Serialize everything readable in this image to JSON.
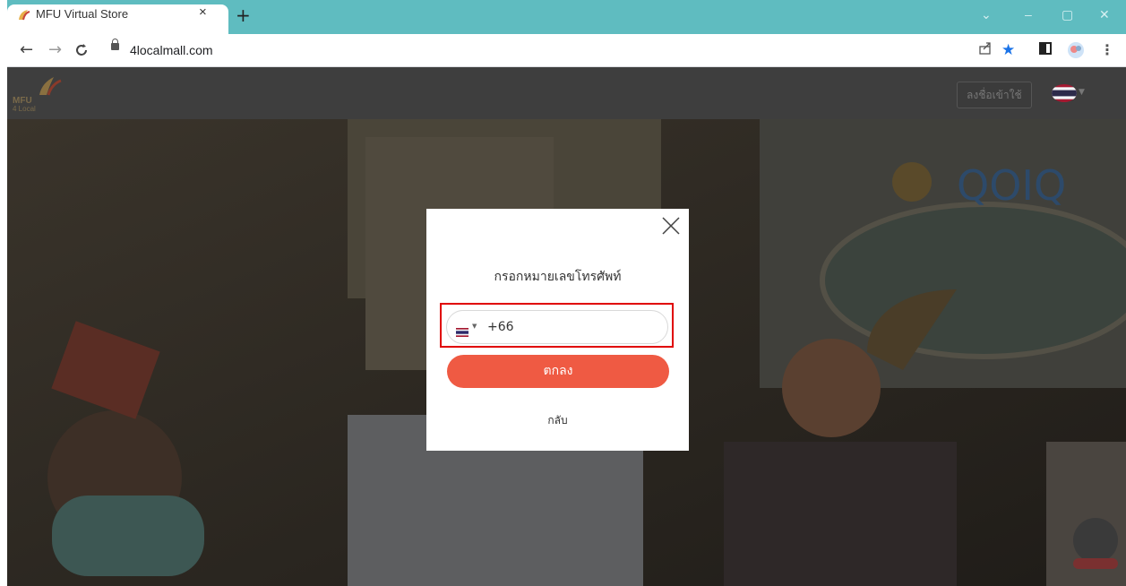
{
  "browser": {
    "tab_title": "MFU Virtual Store",
    "tab_close": "×",
    "new_tab": "+",
    "url": "4localmall.com",
    "controls": {
      "minimize": "–",
      "maximize": "▢",
      "close": "✕",
      "tab_search": "⌄"
    }
  },
  "site": {
    "logo_line1": "MFU",
    "logo_line2": "4 Local",
    "login_label": "ลงชื่อเข้าใช้",
    "language": "Thai flag"
  },
  "modal": {
    "title": "กรอกหมายเลขโทรศัพท์",
    "country_code": "+66",
    "submit_label": "ตกลง",
    "back_label": "กลับ"
  },
  "colors": {
    "tab_strip": "#5fbcc0",
    "submit": "#ef5a43",
    "highlight": "#e00000"
  }
}
